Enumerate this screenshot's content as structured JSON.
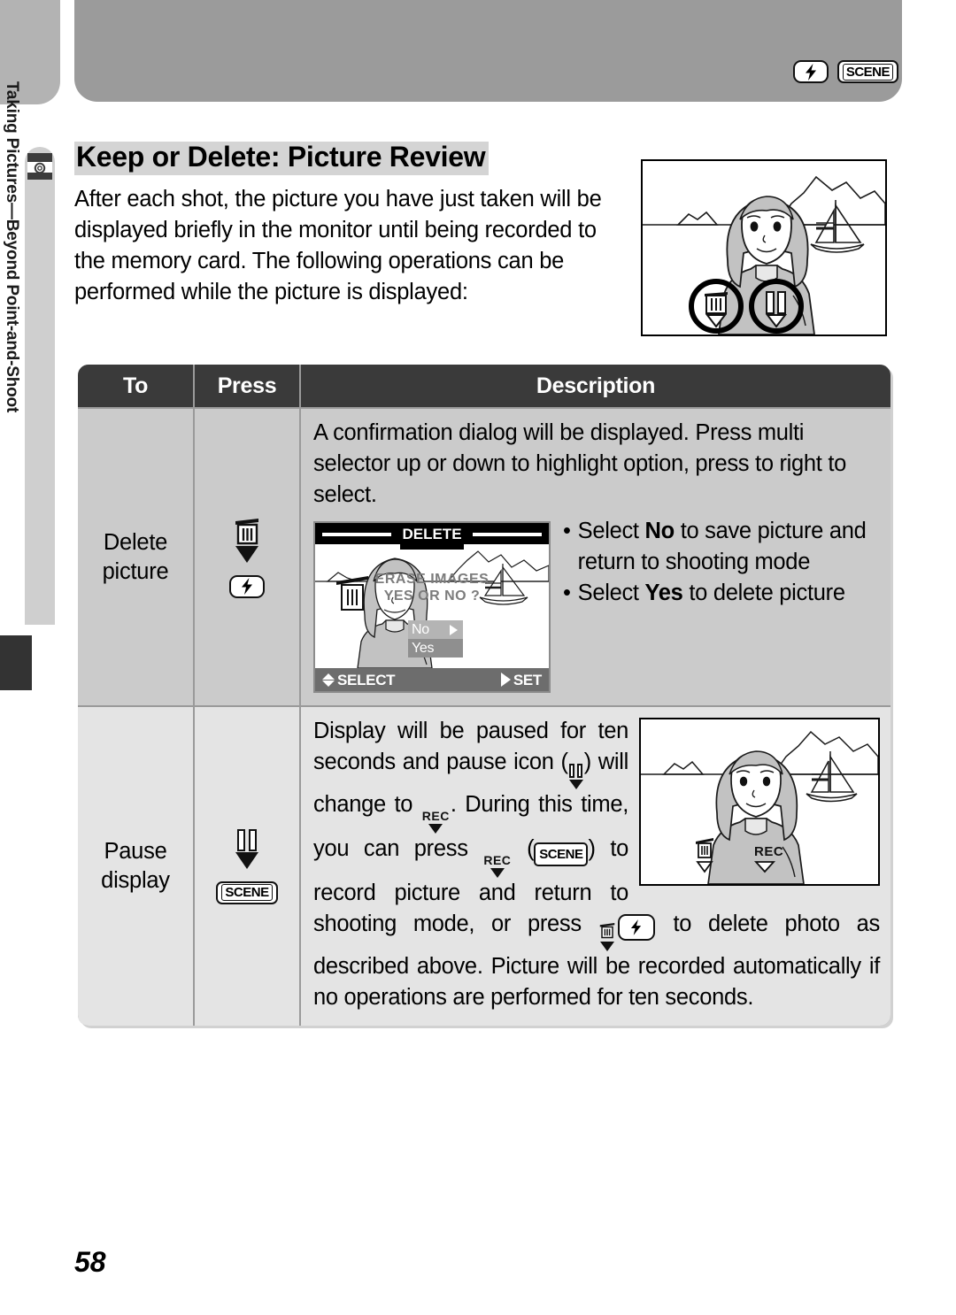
{
  "header": {
    "badges": [
      {
        "icon": "flash-icon",
        "label": ""
      },
      {
        "icon": "scene-badge-icon",
        "label": "SCENE"
      }
    ]
  },
  "sidebar": {
    "icon": "camera-icon",
    "label": "Taking Pictures—Beyond Point-and-Shoot"
  },
  "page": {
    "title": "Keep or Delete: Picture Review",
    "number": "58",
    "intro": "After each shot, the picture you have just taken will be displayed briefly in the monitor until being recorded to the memory card.  The following operations can be performed while the picture is displayed:"
  },
  "table": {
    "headers": {
      "to": "To",
      "press": "Press",
      "description": "Description"
    },
    "rows": [
      {
        "to": "Delete picture",
        "to_line1": "Delete",
        "to_line2": "picture",
        "press_icons": [
          "trash-icon",
          "triangle-down-icon",
          "flash-icon"
        ],
        "press_badge_label": "",
        "desc_paragraph": "A confirmation dialog will be displayed.  Press multi selector up or down to highlight option, press to right to select.",
        "bullets": [
          {
            "pre": "Select ",
            "bold": "No",
            "post": " to save picture and return to shooting mode"
          },
          {
            "pre": "Select ",
            "bold": "Yes",
            "post": " to delete picture"
          }
        ]
      },
      {
        "to": "Pause display",
        "to_line1": "Pause",
        "to_line2": "display",
        "press_icons": [
          "pause-icon",
          "triangle-down-icon",
          "scene-badge-icon"
        ],
        "press_badge_label": "SCENE",
        "desc_part1": "Display will be paused for ten seconds and pause icon (",
        "desc_part2": ") will change to ",
        "desc_part3": ".  During this time, you can press ",
        "desc_part4": " (",
        "desc_scene": "SCENE",
        "desc_part5": ") to record picture and return to shooting mode, or press ",
        "desc_part6": " to delete photo as described above.  Picture will be recorded automatically if no operations are performed for ten seconds."
      }
    ]
  },
  "lcd_delete": {
    "title": "DELETE",
    "overlay_line1": "ERASE IMAGES",
    "overlay_line2": "YES OR NO ?",
    "menu": [
      {
        "label": "No",
        "selected": false,
        "has_arrow": true
      },
      {
        "label": "Yes",
        "selected": true,
        "has_arrow": false
      }
    ],
    "hint_select": "SELECT",
    "hint_set": "SET"
  },
  "illustration_top": {
    "overlay_icons": [
      "trash-icon",
      "pause-icon"
    ],
    "scene": "woman-with-sailboat-and-mountains"
  },
  "illustration_pause": {
    "overlay_icons": [
      "trash-icon",
      "rec-icon"
    ],
    "rec_label": "REC",
    "scene": "woman-with-sailboat-and-mountains"
  },
  "colors": {
    "header_left": "#b3b3b3",
    "header_right": "#9b9b9b",
    "table_header_bg": "#3a3a3a",
    "row1_bg": "#cbcbcb",
    "row2_bg": "#e4e4e4",
    "title_highlight": "#d4d4d4",
    "sidebar_bg": "#cfcfcf",
    "tab_marker": "#333333"
  }
}
